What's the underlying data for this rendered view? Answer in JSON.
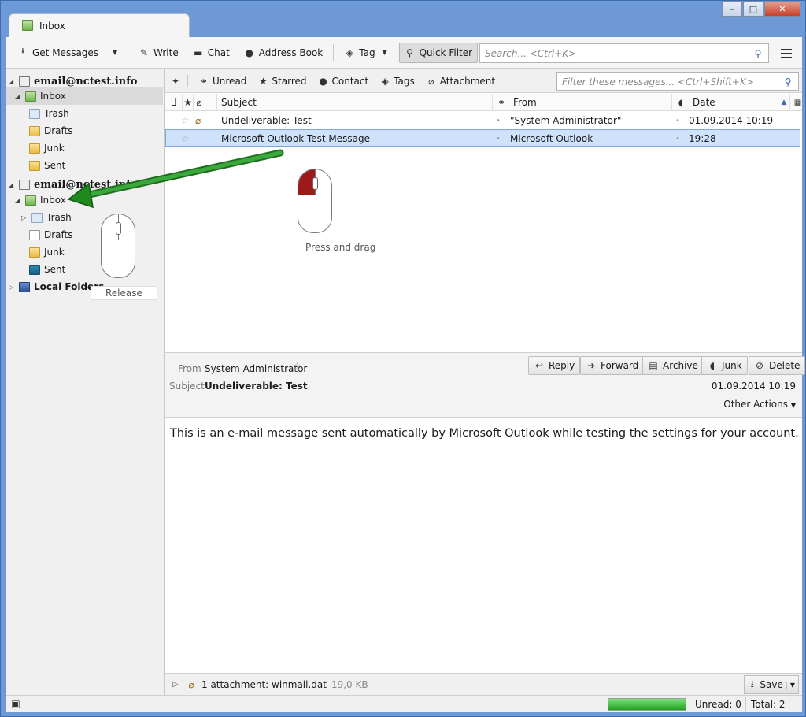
{
  "tab": {
    "title": "Inbox"
  },
  "toolbar": {
    "get_messages": "Get Messages",
    "write": "Write",
    "chat": "Chat",
    "address_book": "Address Book",
    "tag": "Tag",
    "quick_filter": "Quick Filter",
    "search_placeholder": "Search... <Ctrl+K>"
  },
  "sidebar": {
    "account1": "email@nctest.info",
    "account1_folders": [
      "Inbox",
      "Trash",
      "Drafts",
      "Junk",
      "Sent"
    ],
    "account2": "email@nctest.info",
    "account2_folders": [
      "Inbox",
      "Trash",
      "Drafts",
      "Junk",
      "Sent"
    ],
    "local_folders": "Local Folders"
  },
  "quick_filter": {
    "unread": "Unread",
    "starred": "Starred",
    "contact": "Contact",
    "tags": "Tags",
    "attachment": "Attachment",
    "filter_placeholder": "Filter these messages... <Ctrl+Shift+K>"
  },
  "columns": {
    "subject": "Subject",
    "from": "From",
    "date": "Date"
  },
  "messages": [
    {
      "subject": "Undeliverable: Test",
      "from": "\"System Administrator\"",
      "date": "01.09.2014 10:19"
    },
    {
      "subject": "Microsoft Outlook Test Message",
      "from": "Microsoft Outlook",
      "date": "19:28"
    }
  ],
  "overlay": {
    "press_drag": "Press and drag",
    "release": "Release"
  },
  "header": {
    "from_label": "From",
    "from_value": "System Administrator",
    "subject_label": "Subject",
    "subject_value": "Undeliverable: Test",
    "date": "01.09.2014 10:19",
    "other_actions": "Other Actions",
    "reply": "Reply",
    "forward": "Forward",
    "archive": "Archive",
    "junk": "Junk",
    "delete": "Delete"
  },
  "body": {
    "text": "This is an e-mail message sent automatically by Microsoft Outlook while testing the settings for your account."
  },
  "attachment": {
    "summary": "1 attachment: winmail.dat",
    "size": "19,0 KB",
    "save": "Save"
  },
  "status": {
    "unread": "Unread: 0",
    "total": "Total: 2",
    "progress_fraction": 1.0
  },
  "colors": {
    "selection": "#cfe2fb",
    "arrow": "#1e8a1e",
    "progress": "#1fa31f"
  }
}
